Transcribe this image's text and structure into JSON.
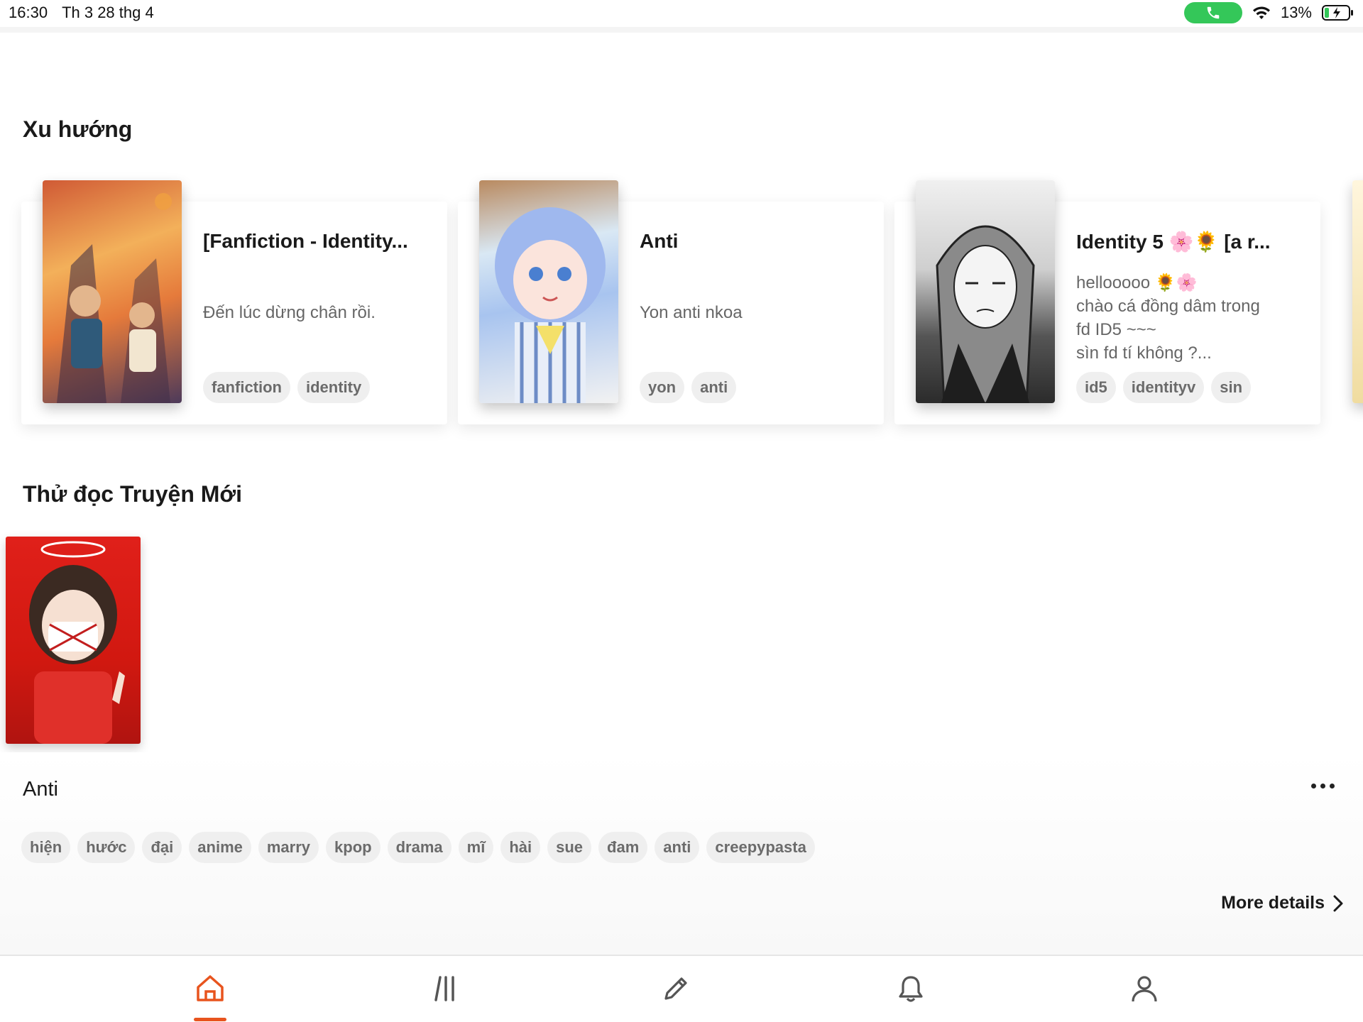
{
  "status_bar": {
    "time": "16:30",
    "date": "Th 3 28 thg 4",
    "battery": "13%",
    "call_icon": "phone-icon",
    "wifi_icon": "wifi-icon",
    "battery_icon": "battery-charging-icon"
  },
  "trending": {
    "title": "Xu hướng",
    "cards": [
      {
        "title": "[Fanfiction - Identity...",
        "description": [
          "Đến lúc dừng chân rồi."
        ],
        "tags": [
          "fanfiction",
          "identity"
        ]
      },
      {
        "title": "Anti",
        "description": [
          "Yon anti nkoa"
        ],
        "tags": [
          "yon",
          "anti"
        ]
      },
      {
        "title": "Identity 5 🌸🌻 [a r...",
        "description": [
          "hellooooo 🌻🌸",
          "chào cá đồng dâm trong",
          "fd ID5 ~~~",
          "sìn fd tí không ?..."
        ],
        "tags": [
          "id5",
          "identityv",
          "sin"
        ]
      }
    ]
  },
  "new_stories": {
    "title": "Thử đọc Truyện Mới",
    "story": {
      "title": "Anti",
      "tags": [
        "hiện",
        "hước",
        "đại",
        "anime",
        "marry",
        "kpop",
        "drama",
        "mĩ",
        "hài",
        "sue",
        "đam",
        "anti",
        "creepypasta"
      ],
      "more_details": "More details"
    }
  },
  "bottom_nav": {
    "items": [
      "home-icon",
      "library-icon",
      "pencil-icon",
      "bell-icon",
      "profile-icon"
    ],
    "active_color": "#e8541e",
    "inactive_color": "#555555"
  }
}
